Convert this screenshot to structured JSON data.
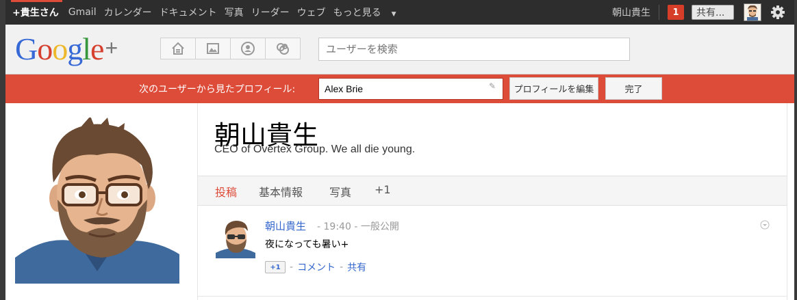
{
  "topbar": {
    "me": "+貴生さん",
    "nav": [
      "Gmail",
      "カレンダー",
      "ドキュメント",
      "写真",
      "リーダー",
      "ウェブ"
    ],
    "more": "もっと見る",
    "username": "朝山貴生",
    "notification_count": "1",
    "share": "共有...",
    "icons": {
      "avatar": "avatar-icon",
      "settings": "gear-icon"
    }
  },
  "header": {
    "logo": {
      "g1": "G",
      "o1": "o",
      "o2": "o",
      "g2": "g",
      "l": "l",
      "e": "e",
      "plus": "+"
    },
    "nav_icons": [
      "home-icon",
      "photos-icon",
      "profile-icon",
      "circles-icon"
    ],
    "search_placeholder": "ユーザーを検索"
  },
  "viewas": {
    "label": "次のユーザーから見たプロフィール:",
    "value": "Alex Brie",
    "edit_button": "プロフィールを編集",
    "done_button": "完了"
  },
  "profile": {
    "name": "朝山貴生",
    "tagline": "CEO of Overtex Group.  We all die young.",
    "tabs": [
      "投稿",
      "基本情報",
      "写真",
      "+1"
    ],
    "active_tab": "投稿"
  },
  "post": {
    "author": "朝山貴生",
    "time": "19:40",
    "visibility": "一般公開",
    "body": "夜になっても暑い+",
    "plus_one": "+1",
    "comment": "コメント",
    "share": "共有"
  },
  "colors": {
    "accent_red": "#dd4b39",
    "link_blue": "#3366cc",
    "topbar": "#2d2d2d"
  }
}
